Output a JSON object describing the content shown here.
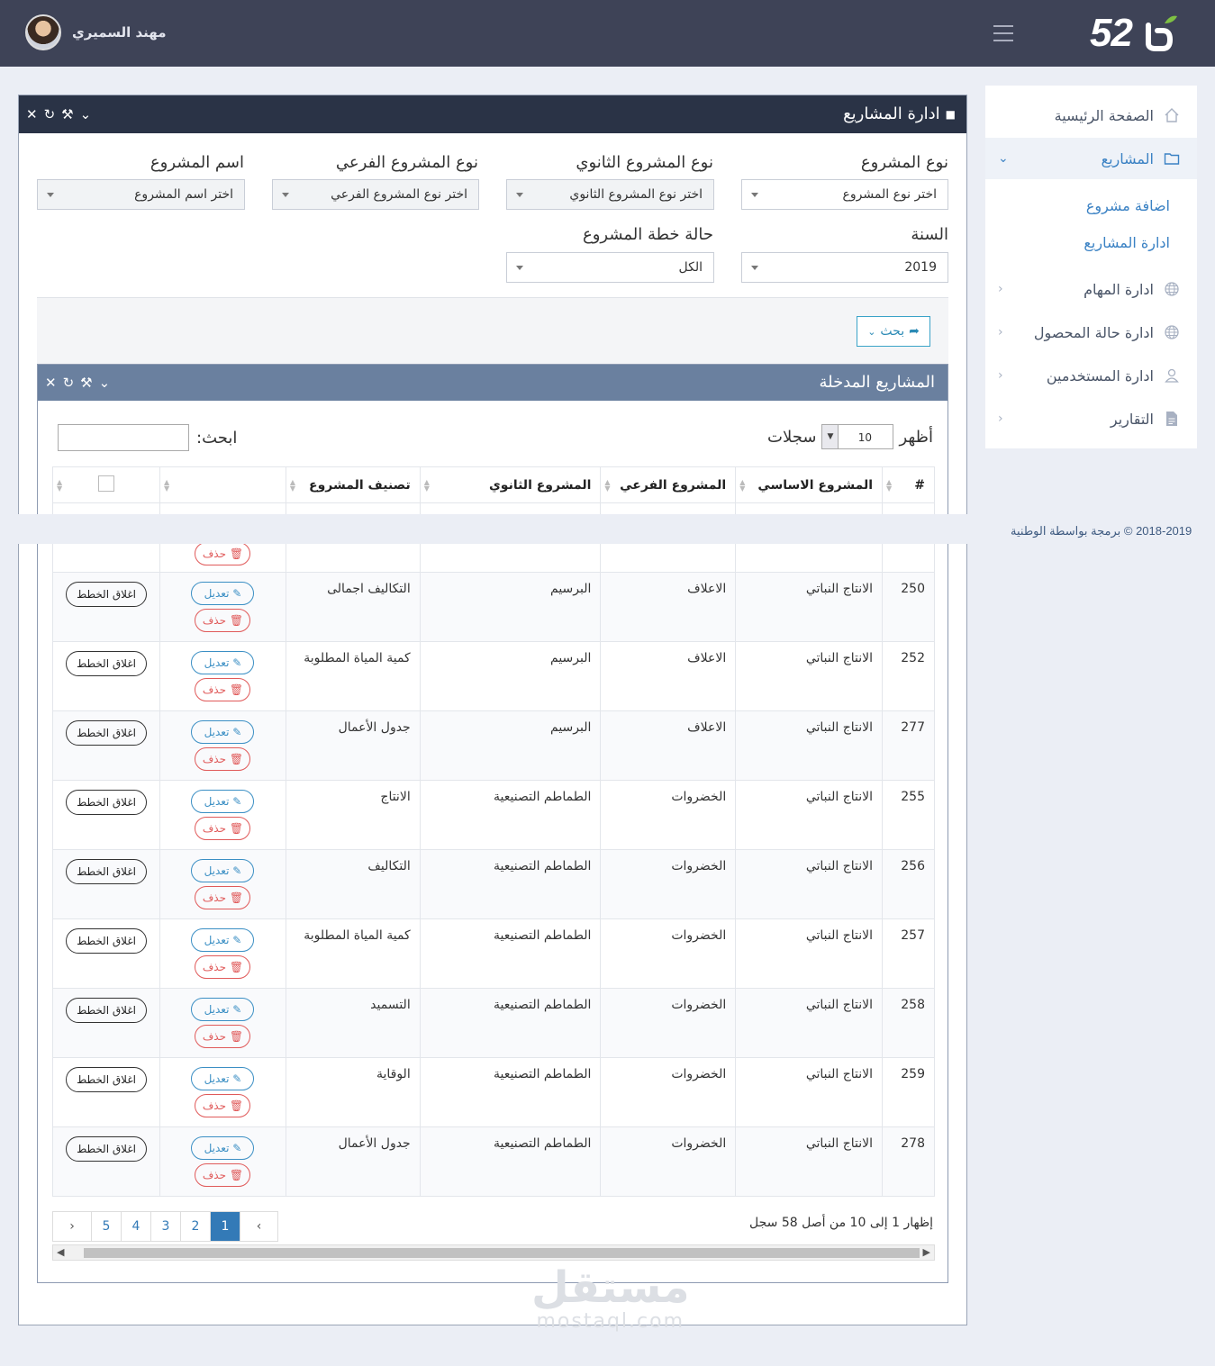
{
  "header": {
    "logo_number": "52",
    "user_name": "مهند السميري"
  },
  "sidebar": {
    "items": [
      {
        "label": "الصفحة الرئيسية",
        "icon": "home-icon"
      },
      {
        "label": "المشاريع",
        "icon": "folder-icon",
        "active": true
      },
      {
        "label": "ادارة المهام",
        "icon": "globe-icon"
      },
      {
        "label": "ادارة حالة المحصول",
        "icon": "globe-icon"
      },
      {
        "label": "ادارة المستخدمين",
        "icon": "user-icon"
      },
      {
        "label": "التقارير",
        "icon": "document-icon"
      }
    ],
    "subitems": [
      "اضافة مشروع",
      "ادارة المشاريع"
    ]
  },
  "footer": {
    "text": "2018-2019 © برمجة بواسطة الوطنية"
  },
  "panel": {
    "title": "ادارة المشاريع"
  },
  "filters": {
    "project_type": {
      "label": "نوع المشروع",
      "value": "اختر نوع المشروع"
    },
    "secondary_type": {
      "label": "نوع المشروع الثانوي",
      "value": "اختر نوع المشروع الثانوي"
    },
    "sub_type": {
      "label": "نوع المشروع الفرعي",
      "value": "اختر نوع المشروع الفرعي"
    },
    "project_name": {
      "label": "اسم المشروع",
      "value": "اختر اسم المشروع"
    },
    "year": {
      "label": "السنة",
      "value": "2019"
    },
    "plan_status": {
      "label": "حالة خطة المشروع",
      "value": "الكل"
    },
    "search_label": "بحث"
  },
  "table_panel": {
    "title": "المشاريع المدخلة",
    "show_label": "أظهر",
    "page_length": "10",
    "records_label": "سجلات",
    "search_label": "ابحث:",
    "columns": [
      "#",
      "المشروع الاساسي",
      "المشروع الفرعي",
      "المشروع الثانوي",
      "تصنيف المشروع",
      "",
      ""
    ],
    "edit_label": "تعديل",
    "delete_label": "حذف",
    "close_label": "اغلاق الخطط",
    "rows": [
      {
        "id": "250",
        "main": "الانتاج النباتي",
        "sub": "الاعلاف",
        "secondary": "البرسيم",
        "category": "التكاليف اجمالى"
      },
      {
        "id": "252",
        "main": "الانتاج النباتي",
        "sub": "الاعلاف",
        "secondary": "البرسيم",
        "category": "كمية المياة المطلوبة"
      },
      {
        "id": "277",
        "main": "الانتاج النباتي",
        "sub": "الاعلاف",
        "secondary": "البرسيم",
        "category": "جدول الأعمال"
      },
      {
        "id": "255",
        "main": "الانتاج النباتي",
        "sub": "الخضروات",
        "secondary": "الطماطم التصنيعية",
        "category": "الانتاج"
      },
      {
        "id": "256",
        "main": "الانتاج النباتي",
        "sub": "الخضروات",
        "secondary": "الطماطم التصنيعية",
        "category": "التكاليف"
      },
      {
        "id": "257",
        "main": "الانتاج النباتي",
        "sub": "الخضروات",
        "secondary": "الطماطم التصنيعية",
        "category": "كمية المياة المطلوبة"
      },
      {
        "id": "258",
        "main": "الانتاج النباتي",
        "sub": "الخضروات",
        "secondary": "الطماطم التصنيعية",
        "category": "التسميد"
      },
      {
        "id": "259",
        "main": "الانتاج النباتي",
        "sub": "الخضروات",
        "secondary": "الطماطم التصنيعية",
        "category": "الوقاية"
      },
      {
        "id": "278",
        "main": "الانتاج النباتي",
        "sub": "الخضروات",
        "secondary": "الطماطم التصنيعية",
        "category": "جدول الأعمال"
      }
    ],
    "info": "إظهار 1 إلى 10 من أصل 58 سجل",
    "pages": [
      "1",
      "2",
      "3",
      "4",
      "5"
    ]
  },
  "watermark": {
    "ar": "مستقل",
    "en": "mostaql.com"
  }
}
